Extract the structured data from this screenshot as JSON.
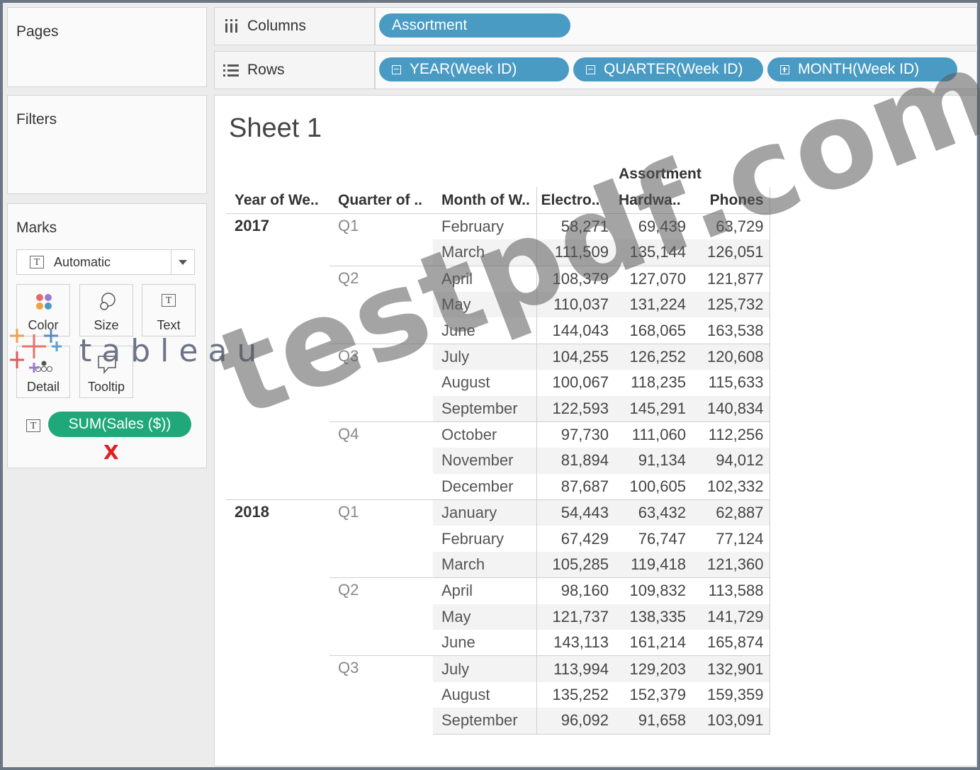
{
  "left_panels": {
    "pages_title": "Pages",
    "filters_title": "Filters",
    "marks_title": "Marks",
    "mark_type": "Automatic",
    "mark_buttons": {
      "color": "Color",
      "size": "Size",
      "text": "Text",
      "detail": "Detail",
      "tooltip": "Tooltip"
    },
    "measure_pill": "SUM(Sales ($))",
    "remove_mark": "X"
  },
  "shelves": {
    "columns_label": "Columns",
    "rows_label": "Rows",
    "columns_pills": [
      "Assortment"
    ],
    "rows_pills": [
      "YEAR(Week ID)",
      "QUARTER(Week ID)",
      "MONTH(Week ID)"
    ]
  },
  "sheet": {
    "title": "Sheet 1",
    "column_group_header": "Assortment",
    "row_headers": [
      "Year of We..",
      "Quarter of ..",
      "Month of W.."
    ],
    "column_headers": [
      "Electro..",
      "Hardwa..",
      "Phones"
    ],
    "rows": [
      {
        "year": "2017",
        "quarter": "Q1",
        "month": "February",
        "v": [
          "58,271",
          "69,439",
          "63,729"
        ]
      },
      {
        "year": "",
        "quarter": "",
        "month": "March",
        "v": [
          "111,509",
          "135,144",
          "126,051"
        ]
      },
      {
        "year": "",
        "quarter": "Q2",
        "month": "April",
        "v": [
          "108,379",
          "127,070",
          "121,877"
        ]
      },
      {
        "year": "",
        "quarter": "",
        "month": "May",
        "v": [
          "110,037",
          "131,224",
          "125,732"
        ]
      },
      {
        "year": "",
        "quarter": "",
        "month": "June",
        "v": [
          "144,043",
          "168,065",
          "163,538"
        ]
      },
      {
        "year": "",
        "quarter": "Q3",
        "month": "July",
        "v": [
          "104,255",
          "126,252",
          "120,608"
        ]
      },
      {
        "year": "",
        "quarter": "",
        "month": "August",
        "v": [
          "100,067",
          "118,235",
          "115,633"
        ]
      },
      {
        "year": "",
        "quarter": "",
        "month": "September",
        "v": [
          "122,593",
          "145,291",
          "140,834"
        ]
      },
      {
        "year": "",
        "quarter": "Q4",
        "month": "October",
        "v": [
          "97,730",
          "111,060",
          "112,256"
        ]
      },
      {
        "year": "",
        "quarter": "",
        "month": "November",
        "v": [
          "81,894",
          "91,134",
          "94,012"
        ]
      },
      {
        "year": "",
        "quarter": "",
        "month": "December",
        "v": [
          "87,687",
          "100,605",
          "102,332"
        ]
      },
      {
        "year": "2018",
        "quarter": "Q1",
        "month": "January",
        "v": [
          "54,443",
          "63,432",
          "62,887"
        ]
      },
      {
        "year": "",
        "quarter": "",
        "month": "February",
        "v": [
          "67,429",
          "76,747",
          "77,124"
        ]
      },
      {
        "year": "",
        "quarter": "",
        "month": "March",
        "v": [
          "105,285",
          "119,418",
          "121,360"
        ]
      },
      {
        "year": "",
        "quarter": "Q2",
        "month": "April",
        "v": [
          "98,160",
          "109,832",
          "113,588"
        ]
      },
      {
        "year": "",
        "quarter": "",
        "month": "May",
        "v": [
          "121,737",
          "138,335",
          "141,729"
        ]
      },
      {
        "year": "",
        "quarter": "",
        "month": "June",
        "v": [
          "143,113",
          "161,214",
          "165,874"
        ]
      },
      {
        "year": "",
        "quarter": "Q3",
        "month": "July",
        "v": [
          "113,994",
          "129,203",
          "132,901"
        ]
      },
      {
        "year": "",
        "quarter": "",
        "month": "August",
        "v": [
          "135,252",
          "152,379",
          "159,359"
        ]
      },
      {
        "year": "",
        "quarter": "",
        "month": "September",
        "v": [
          "96,092",
          "91,658",
          "103,091"
        ]
      }
    ]
  },
  "overlays": {
    "watermark": "testpdf.com",
    "logo_text": "tableau"
  },
  "colors": {
    "dimension_pill": "#4a9bc4",
    "measure_pill": "#1fa87a",
    "remove_x": "#e02020"
  }
}
